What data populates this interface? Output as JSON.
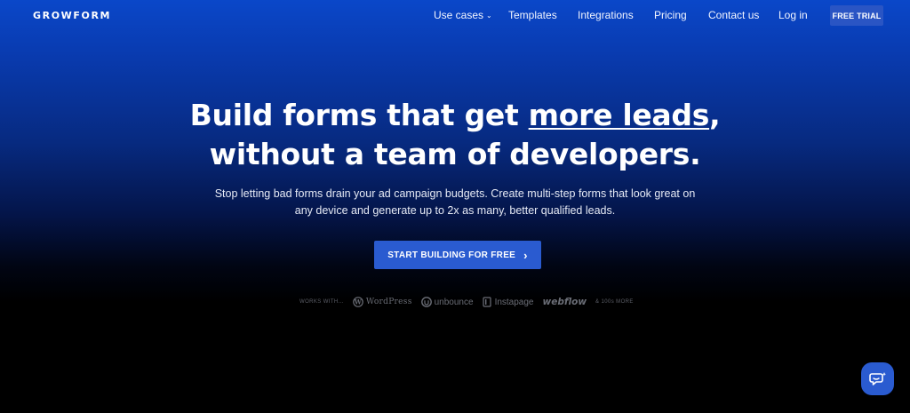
{
  "header": {
    "logo": "GROWFORM",
    "nav": [
      {
        "label": "Use cases",
        "has_dropdown": true
      },
      {
        "label": "Templates"
      },
      {
        "label": "Integrations"
      },
      {
        "label": "Pricing"
      },
      {
        "label": "Contact us"
      },
      {
        "label": "Log in"
      }
    ],
    "trial_button": "FREE TRIAL"
  },
  "hero": {
    "headline_part1": "Build forms that get ",
    "headline_highlight": "more leads",
    "headline_part2": ",",
    "headline_line2": "without a team of developers.",
    "subtext": "Stop letting bad forms drain your ad campaign budgets. Create multi-step forms that look great on any device and generate up to 2x as many, better qualified leads.",
    "cta_label": "START BUILDING FOR FREE",
    "cta_arrow": "›"
  },
  "integrations": {
    "prefix": "WORKS WITH...",
    "brands": [
      "WordPress",
      "unbounce",
      "Instapage",
      "webflow"
    ],
    "suffix": "& 100s MORE"
  },
  "colors": {
    "accent": "#2a5bd0",
    "gradient_top": "#0a47c9",
    "background": "#000000"
  },
  "icons": {
    "chat_button": "chat-bubble-icon"
  }
}
